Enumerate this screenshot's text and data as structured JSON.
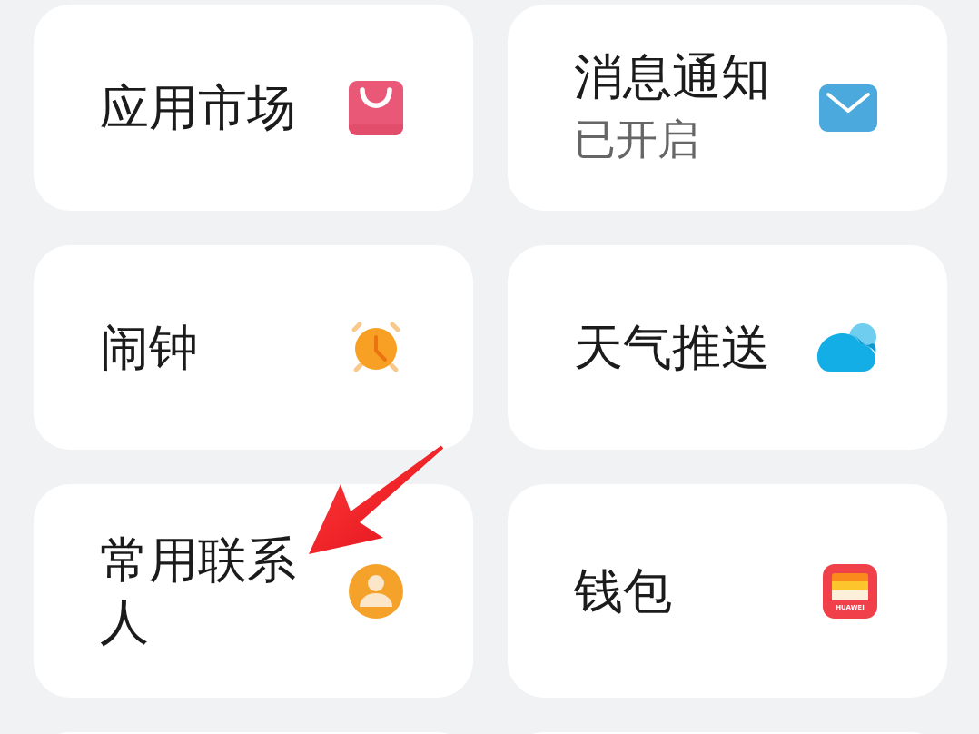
{
  "rows": [
    {
      "tiles": [
        {
          "kind": "market",
          "title": "应用市场"
        },
        {
          "kind": "notification",
          "title": "消息通知",
          "status": "已开启"
        }
      ]
    },
    {
      "tiles": [
        {
          "kind": "alarm",
          "title": "闹钟"
        },
        {
          "kind": "weather",
          "title": "天气推送"
        }
      ]
    },
    {
      "tiles": [
        {
          "kind": "contacts",
          "title": "常用联系人"
        },
        {
          "kind": "wallet",
          "title": "钱包",
          "icon_text": "HUAWEI"
        }
      ]
    }
  ]
}
